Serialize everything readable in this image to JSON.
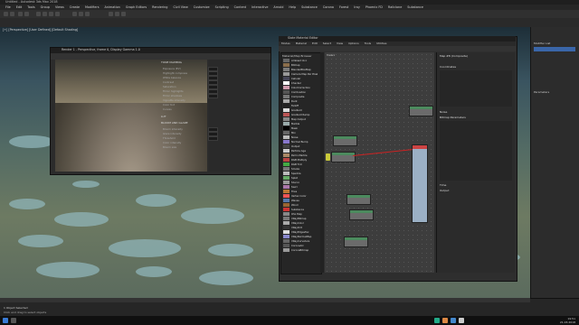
{
  "app": {
    "title": "Untitled - Autodesk 3ds Max 2018",
    "menus": [
      "File",
      "Edit",
      "Tools",
      "Group",
      "Views",
      "Create",
      "Modifiers",
      "Animation",
      "Graph Editors",
      "Rendering",
      "Civil View",
      "Customize",
      "Scripting",
      "Content",
      "Interactive",
      "Arnold",
      "Help",
      "Substance",
      "Corona",
      "Forest",
      "Iray",
      "Phoenix FD",
      "Railclone",
      "Substance"
    ]
  },
  "viewport": {
    "label": "[+] [Perspective] [User Defined] [Default Shading]"
  },
  "render_window": {
    "title": "Render 1 - Perspective, frame 0, Display Gamma 1.0",
    "sections": [
      "TONE MAPPING",
      "LUT",
      "BLOOM AND GLARE"
    ],
    "rows": [
      "Exposure (EV)",
      "Highlight compress",
      "White balance",
      "Contrast",
      "Saturation",
      "Filmic highlights",
      "Filmic shadows",
      "Vignette intensity",
      "Color tint",
      "Curves",
      "Bloom intensity",
      "Glare intensity",
      "Threshold",
      "Color intensity",
      "Bloom size"
    ]
  },
  "sme": {
    "title": "Slate Material Editor",
    "menus": [
      "Modes",
      "Material",
      "Edit",
      "Select",
      "View",
      "Options",
      "Tools",
      "Utilities"
    ],
    "browser_header": "Material/Map Browser",
    "map_items": [
      "Ambient Occ",
      "Bitmap",
      "BlendedBoxMap",
      "Camera Map Per Pixel",
      "Cellular",
      "Checker",
      "ColorCorrection",
      "Combustion",
      "Composite",
      "Dent",
      "Falloff",
      "Gradient",
      "Gradient Ramp",
      "Map Output",
      "Marble",
      "Mask",
      "Mix",
      "Noise",
      "Normal Bump",
      "Output",
      "Particle Age",
      "Perlin Marble",
      "RGB Multiply",
      "RGB Tint",
      "Smoke",
      "Speckle",
      "Splat",
      "Stucco",
      "Swirl",
      "Tiles",
      "Vertex Color",
      "Waves",
      "Wood",
      "Substance",
      "OSL Map",
      "VRayBitmap",
      "VRayColor",
      "VRayDirt",
      "VRayEdgesTex",
      "VRayNormalMap",
      "VRayCurvature",
      "CoronaAO",
      "CoronaBitmap"
    ],
    "view_tab": "View1",
    "params_header": "Map #8 (Composite)",
    "params_sections": [
      "Coordinates",
      "Noise",
      "Bitmap Parameters",
      "Time",
      "Output"
    ]
  },
  "command_panel": {
    "title": "Modifier List",
    "section": "Parameters"
  },
  "status": {
    "left": "1 Object Selected",
    "prompt": "Click and drag to select objects"
  },
  "taskbar": {
    "time": "19:51",
    "date": "21.03.2018"
  },
  "colors": {
    "accent": "#c22222",
    "node_header": "#4c8a5e"
  }
}
